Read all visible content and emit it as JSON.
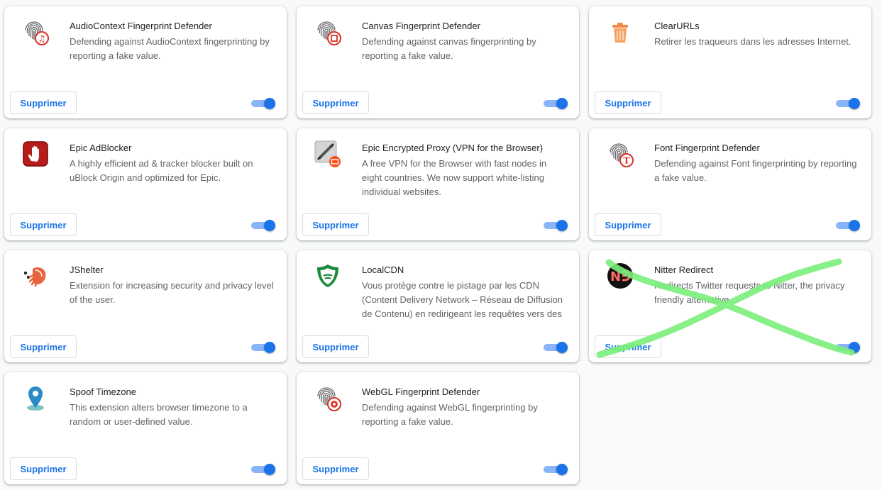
{
  "remove_label": "Supprimer",
  "accent_color": "#1a73e8",
  "annotation_color": "#7bef7b",
  "extensions": [
    {
      "name": "AudioContext Fingerprint Defender",
      "description": "Defending against AudioContext fingerprinting by reporting a fake value.",
      "icon": "fingerprint-audio-icon",
      "enabled": true
    },
    {
      "name": "Canvas Fingerprint Defender",
      "description": "Defending against canvas fingerprinting by reporting a fake value.",
      "icon": "fingerprint-canvas-icon",
      "enabled": true
    },
    {
      "name": "ClearURLs",
      "description": "Retirer les traqueurs dans les adresses Internet.",
      "icon": "trash-icon",
      "enabled": true
    },
    {
      "name": "Epic AdBlocker",
      "description": "A highly efficient ad & tracker blocker built on uBlock Origin and optimized for Epic.",
      "icon": "hand-stop-icon",
      "enabled": true
    },
    {
      "name": "Epic Encrypted Proxy (VPN for the Browser)",
      "description": "A free VPN for the Browser with fast nodes in eight countries. We now support white-listing individual websites.",
      "icon": "proxy-plug-icon",
      "enabled": true
    },
    {
      "name": "Font Fingerprint Defender",
      "description": "Defending against Font fingerprinting by reporting a fake value.",
      "icon": "fingerprint-font-icon",
      "enabled": true
    },
    {
      "name": "JShelter",
      "description": "Extension for increasing security and privacy level of the user.",
      "icon": "hermit-crab-icon",
      "enabled": true
    },
    {
      "name": "LocalCDN",
      "description": "Vous protège contre le pistage par les CDN (Content Delivery Network – Réseau de Diffusion de Contenu) en redirigeant les requêtes vers des",
      "icon": "shield-icon",
      "enabled": true
    },
    {
      "name": "Nitter Redirect",
      "description": "Redirects Twitter requests to Nitter, the privacy friendly alternative.",
      "icon": "nitter-logo-icon",
      "enabled": true
    },
    {
      "name": "Spoof Timezone",
      "description": "This extension alters browser timezone to a random or user-defined value.",
      "icon": "map-pin-icon",
      "enabled": true
    },
    {
      "name": "WebGL Fingerprint Defender",
      "description": "Defending against WebGL fingerprinting by reporting a fake value.",
      "icon": "fingerprint-webgl-icon",
      "enabled": true
    }
  ]
}
